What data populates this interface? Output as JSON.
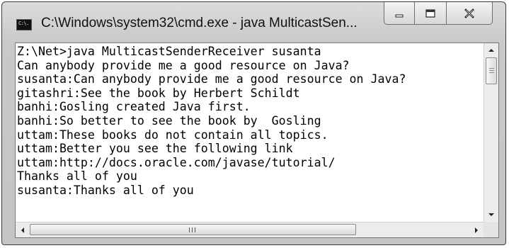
{
  "window": {
    "title": "C:\\Windows\\system32\\cmd.exe - java  MulticastSen...",
    "icon": "cmd-icon",
    "icon_glyph": "C:\\.",
    "buttons": {
      "minimize": "minimize-icon",
      "maximize": "maximize-icon",
      "close": "close-icon"
    }
  },
  "console": {
    "lines": [
      "Z:\\Net>java MulticastSenderReceiver susanta",
      "Can anybody provide me a good resource on Java?",
      "susanta:Can anybody provide me a good resource on Java?",
      "gitashri:See the book by Herbert Schildt",
      "banhi:Gosling created Java first.",
      "banhi:So better to see the book by  Gosling",
      "uttam:These books do not contain all topics.",
      "uttam:Better you see the following link",
      "uttam:http://docs.oracle.com/javase/tutorial/",
      "Thanks all of you",
      "susanta:Thanks all of you",
      ""
    ],
    "text_color": "#000000",
    "background_color": "#ffffff"
  },
  "scrollbars": {
    "vertical": {
      "up_icon": "arrow-up-icon",
      "down_icon": "arrow-down-icon",
      "position": 0
    },
    "horizontal": {
      "left_icon": "arrow-left-icon",
      "right_icon": "arrow-right-icon",
      "position": 0
    }
  }
}
